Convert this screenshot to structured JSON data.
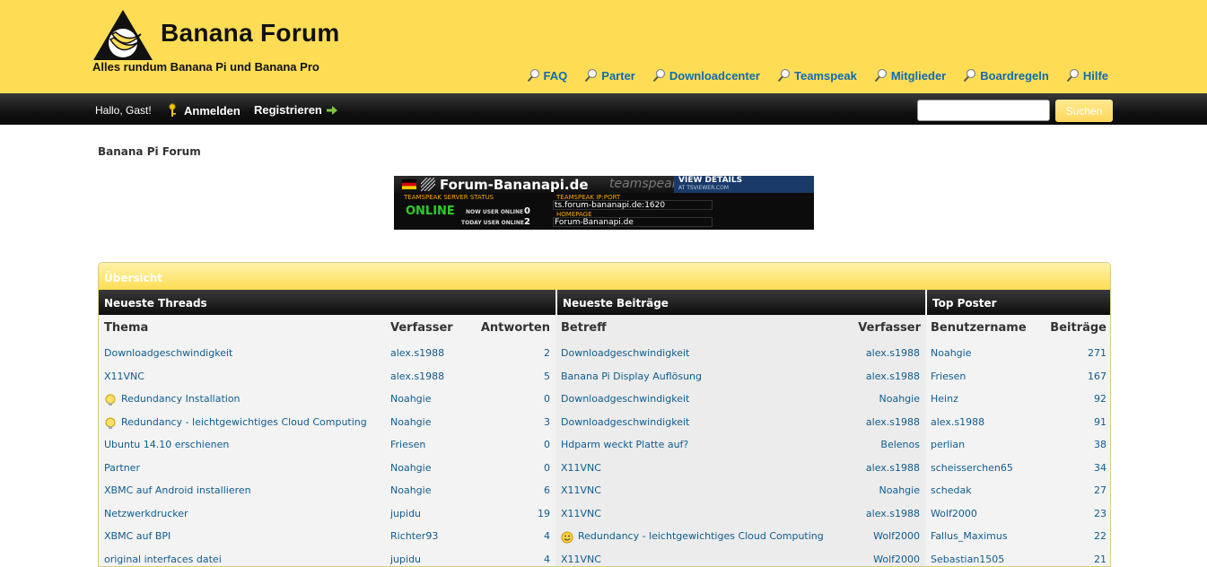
{
  "header": {
    "site_title": "Banana Forum",
    "tagline": "Alles rundum Banana Pi und Banana Pro",
    "nav": [
      {
        "label": "FAQ"
      },
      {
        "label": "Parter"
      },
      {
        "label": "Downloadcenter"
      },
      {
        "label": "Teamspeak"
      },
      {
        "label": "Mitglieder"
      },
      {
        "label": "Boardregeln"
      },
      {
        "label": "Hilfe"
      }
    ]
  },
  "userbar": {
    "greeting": "Hallo, Gast!",
    "login_label": "Anmelden",
    "register_label": "Registrieren",
    "search_value": "",
    "search_button": "Suchen"
  },
  "breadcrumb": "Banana Pi Forum",
  "banner": {
    "server_name": "Forum-Bananapi.de",
    "product": "teamspeak 3",
    "view_details": "VIEW DETAILS",
    "view_sub": "AT TSVIEWER.COM",
    "status_label": "TEAMSPEAK SERVER STATUS",
    "status": "ONLINE",
    "now_label": "NOW USER ONLINE",
    "now_value": "0",
    "today_label": "TODAY USER ONLINE",
    "today_value": "2",
    "ip_label": "TEAMSPEAK IP:PORT",
    "ip_value": "ts.forum-bananapi.de:1620",
    "home_label": "HOMEPAGE",
    "home_value": "Forum-Bananapi.de"
  },
  "overview": {
    "title": "Übersicht",
    "threads": {
      "heading": "Neueste Threads",
      "col_topic": "Thema",
      "col_author": "Verfasser",
      "col_replies": "Antworten",
      "rows": [
        {
          "title": "Downloadgeschwindigkeit",
          "author": "alex.s1988",
          "replies": "2",
          "icon": ""
        },
        {
          "title": "X11VNC",
          "author": "alex.s1988",
          "replies": "5",
          "icon": ""
        },
        {
          "title": "Redundancy Installation",
          "author": "Noahgie",
          "replies": "0",
          "icon": "bulb-icon"
        },
        {
          "title": "Redundancy - leichtgewichtiges Cloud Computing",
          "author": "Noahgie",
          "replies": "3",
          "icon": "bulb-icon"
        },
        {
          "title": "Ubuntu 14.10 erschienen",
          "author": "Friesen",
          "replies": "0",
          "icon": ""
        },
        {
          "title": "Partner",
          "author": "Noahgie",
          "replies": "0",
          "icon": ""
        },
        {
          "title": "XBMC auf Android installieren",
          "author": "Noahgie",
          "replies": "6",
          "icon": ""
        },
        {
          "title": "Netzwerkdrucker",
          "author": "jupidu",
          "replies": "19",
          "icon": ""
        },
        {
          "title": "XBMC auf BPI",
          "author": "Richter93",
          "replies": "4",
          "icon": ""
        },
        {
          "title": "original interfaces datei",
          "author": "jupidu",
          "replies": "4",
          "icon": ""
        }
      ]
    },
    "posts": {
      "heading": "Neueste Beiträge",
      "col_subject": "Betreff",
      "col_author": "Verfasser",
      "rows": [
        {
          "subject": "Downloadgeschwindigkeit",
          "author": "alex.s1988",
          "icon": ""
        },
        {
          "subject": "Banana Pi Display Auflösung",
          "author": "alex.s1988",
          "icon": ""
        },
        {
          "subject": "Downloadgeschwindigkeit",
          "author": "Noahgie",
          "icon": ""
        },
        {
          "subject": "Downloadgeschwindigkeit",
          "author": "alex.s1988",
          "icon": ""
        },
        {
          "subject": "Hdparm weckt Platte auf?",
          "author": "Belenos",
          "icon": ""
        },
        {
          "subject": "X11VNC",
          "author": "alex.s1988",
          "icon": ""
        },
        {
          "subject": "X11VNC",
          "author": "Noahgie",
          "icon": ""
        },
        {
          "subject": "X11VNC",
          "author": "alex.s1988",
          "icon": ""
        },
        {
          "subject": "Redundancy - leichtgewichtiges Cloud Computing",
          "author": "Wolf2000",
          "icon": "smiley-icon"
        },
        {
          "subject": "X11VNC",
          "author": "Wolf2000",
          "icon": ""
        }
      ]
    },
    "top_posters": {
      "heading": "Top Poster",
      "col_user": "Benutzername",
      "col_posts": "Beiträge",
      "rows": [
        {
          "user": "Noahgie",
          "posts": "271"
        },
        {
          "user": "Friesen",
          "posts": "167"
        },
        {
          "user": "Heinz",
          "posts": "92"
        },
        {
          "user": "alex.s1988",
          "posts": "91"
        },
        {
          "user": "perlian",
          "posts": "38"
        },
        {
          "user": "scheisserchen65",
          "posts": "34"
        },
        {
          "user": "schedak",
          "posts": "27"
        },
        {
          "user": "Wolf2000",
          "posts": "23"
        },
        {
          "user": "Fallus_Maximus",
          "posts": "22"
        },
        {
          "user": "Sebastian1505",
          "posts": "21"
        }
      ]
    }
  }
}
